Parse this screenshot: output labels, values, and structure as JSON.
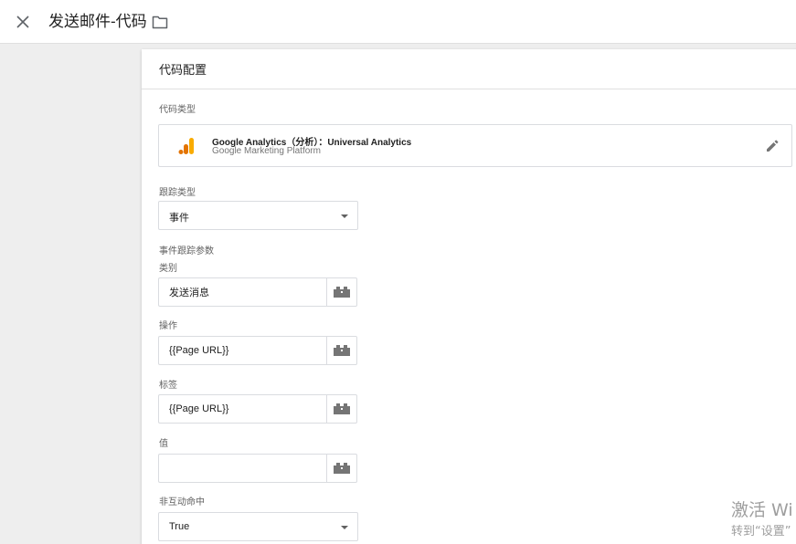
{
  "header": {
    "title": "发送邮件-代码"
  },
  "config": {
    "section_title": "代码配置",
    "tag_type_label": "代码类型",
    "tag_type": {
      "name": "Google Analytics（分析）：Universal Analytics",
      "platform": "Google Marketing Platform"
    },
    "track_type": {
      "label": "跟踪类型",
      "value": "事件"
    },
    "event_params_label": "事件跟踪参数",
    "category": {
      "label": "类别",
      "value": "发送消息"
    },
    "action": {
      "label": "操作",
      "value": "{{Page URL}}"
    },
    "event_label": {
      "label": "标签",
      "value": "{{Page URL}}"
    },
    "event_value": {
      "label": "值",
      "value": ""
    },
    "non_interaction": {
      "label": "非互动命中",
      "value": "True"
    }
  },
  "watermark": {
    "line1": "激活 Wi",
    "line2": "转到“设置”"
  },
  "colors": {
    "ga_orange": "#f9ab00",
    "ga_dark_orange": "#e37400",
    "icon_gray": "#757575"
  }
}
